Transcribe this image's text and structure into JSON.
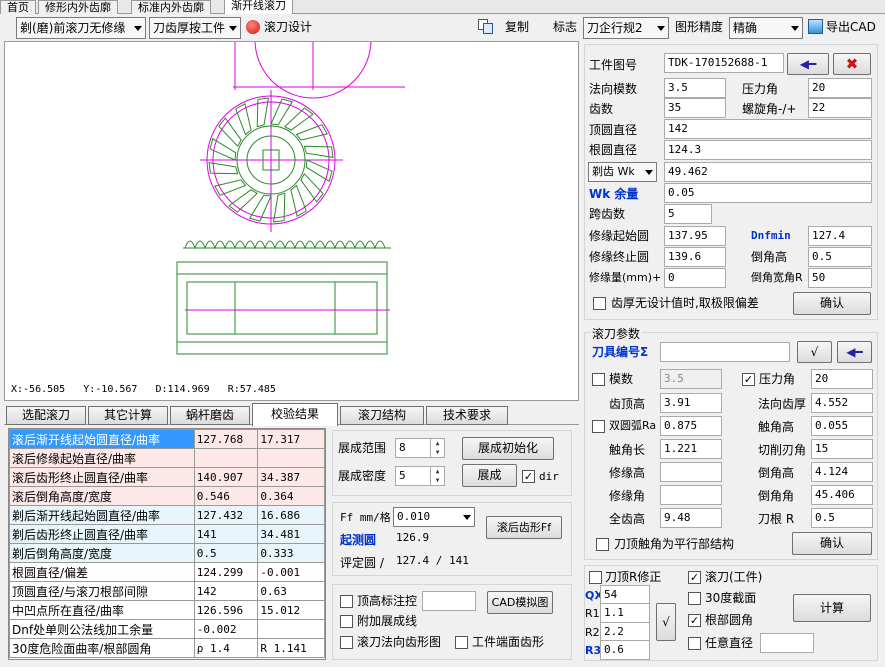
{
  "tabs": [
    "首页",
    "修形内外齿廓",
    "标准内外齿廓",
    "渐开线滚刀"
  ],
  "toolbar": {
    "mode_select": "剃(磨)前滚刀无修缘",
    "thickness_select": "刀齿厚按工件",
    "design_label": "滚刀设计",
    "copy_label": "复制",
    "mark_label": "标志",
    "mark_select": "刀企行规2",
    "precision_label": "图形精度",
    "precision_select": "精确",
    "export_label": "导出CAD"
  },
  "status_coords": "X:-56.505   Y:-10.567   D:114.969   R:57.485",
  "bottom_tabs": [
    "选配滚刀",
    "其它计算",
    "蜗杆磨齿",
    "校验结果",
    "滚刀结构",
    "技术要求"
  ],
  "results": [
    {
      "label": "滚后渐开线起始圆直径/曲率",
      "v1": "127.768",
      "v2": "17.317"
    },
    {
      "label": "滚后修缘起始直径/曲率",
      "v1": "",
      "v2": ""
    },
    {
      "label": "滚后齿形终止圆直径/曲率",
      "v1": "140.907",
      "v2": "34.387"
    },
    {
      "label": "滚后倒角高度/宽度",
      "v1": "0.546",
      "v2": "0.364"
    },
    {
      "label": "剃后渐开线起始圆直径/曲率",
      "v1": "127.432",
      "v2": "16.686"
    },
    {
      "label": "剃后齿形终止圆直径/曲率",
      "v1": "141",
      "v2": "34.481"
    },
    {
      "label": "剃后倒角高度/宽度",
      "v1": "0.5",
      "v2": "0.333"
    },
    {
      "label": "根圆直径/偏差",
      "v1": "124.299",
      "v2": "-0.001"
    },
    {
      "label": "顶圆直径/与滚刀根部间隙",
      "v1": "142",
      "v2": "0.63"
    },
    {
      "label": "中凹点所在直径/曲率",
      "v1": "126.596",
      "v2": "15.012"
    },
    {
      "label": "Dnf处单则公法线加工余量",
      "v1": "-0.002",
      "v2": ""
    },
    {
      "label": "30度危险面曲率/根部圆角",
      "v1": "ρ  1.4",
      "v2": "R 1.141"
    }
  ],
  "mid": {
    "range_label": "展成范围",
    "range_val": "8",
    "density_label": "展成密度",
    "density_val": "5",
    "init_btn": "展成初始化",
    "gen_btn": "展成",
    "dir_label": "dir",
    "ff_label": "Ff mm/格",
    "ff_val": "0.010",
    "shape_btn": "滚后齿形Ff",
    "start_label": "起测圆",
    "start_val": "126.9",
    "eval_label": "评定圆 /",
    "eval_val": "127.4 / 141",
    "top_mark": "顶高标注控",
    "cad_btn": "CAD模拟图",
    "add_line": "附加展成线",
    "hob_normal": "滚刀法向齿形图",
    "work_end": "工件端面齿形"
  },
  "workpiece": {
    "drawing_label": "工件图号",
    "drawing_val": "TDK-170152688-1",
    "module_label": "法向模数",
    "module_val": "3.5",
    "pressure_label": "压力角",
    "pressure_val": "20",
    "teeth_label": "齿数",
    "teeth_val": "35",
    "helix_label": "螺旋角-/+",
    "helix_val": "22",
    "tip_label": "顶圆直径",
    "tip_val": "142",
    "root_label": "根圆直径",
    "root_val": "124.3",
    "wk_select": "剃齿 Wk",
    "wk_val": "49.462",
    "allow_label": "Wk 余量",
    "allow_val": "0.05",
    "span_label": "跨齿数",
    "span_val": "5",
    "mod_start_label": "修缘起始圆",
    "mod_start_val": "137.95",
    "dnf_label": "Dnfmin",
    "dnf_val": "127.4",
    "mod_end_label": "修缘终止圆",
    "mod_end_val": "139.6",
    "ch_h_label": "倒角高",
    "ch_h_val": "0.5",
    "mod_amt_label": "修缘量(mm)+",
    "mod_amt_val": "0",
    "ch_w_label": "倒角宽角R",
    "ch_w_val": "50",
    "limit_label": "齿厚无设计值时,取极限偏差",
    "ok": "确认"
  },
  "hob": {
    "title": "滚刀参数",
    "tool_no": "刀具编号Σ",
    "module_label": "模数",
    "module_val": "3.5",
    "pa_label": "压力角",
    "pa_val": "20",
    "tip_h_label": "齿顶高",
    "tip_h_val": "3.91",
    "normal_t_label": "法向齿厚",
    "normal_t_val": "4.552",
    "arc_label": "双圆弧Ra",
    "arc_val": "0.875",
    "touch_h_label": "触角高",
    "touch_h_val": "0.055",
    "touch_len_label": "触角长",
    "touch_len_val": "1.221",
    "cut_label": "切削刃角",
    "cut_val": "15",
    "edge_h_label": "修缘高",
    "edge_h_val": "",
    "ch_h_label": "倒角高",
    "ch_h_val": "4.124",
    "edge_a_label": "修缘角",
    "edge_a_val": "",
    "ch_a_label": "倒角角",
    "ch_a_val": "45.406",
    "full_label": "全齿高",
    "full_val": "9.48",
    "r_label": "刀根 R",
    "r_val": "0.5",
    "parallel_label": "刀顶触角为平行部结构",
    "ok": "确认"
  },
  "bottom_right": {
    "tip_r": "刀顶R修正",
    "qx": "QX",
    "qx_val": "54",
    "r1": "R1",
    "r1_val": "1.1",
    "r2": "R2",
    "r2_val": "2.2",
    "r3": "R3",
    "r3_val": "0.6",
    "hob_work": "滚刀(工件)",
    "sec30": "30度截面",
    "root_round": "根部圆角",
    "any_dia": "任意直径",
    "calc": "计算"
  },
  "colors": {
    "accent": "#0033cc",
    "drawing_pink": "#e000e0",
    "drawing_green": "#2a8a2a",
    "result_header": "#3399ff"
  }
}
